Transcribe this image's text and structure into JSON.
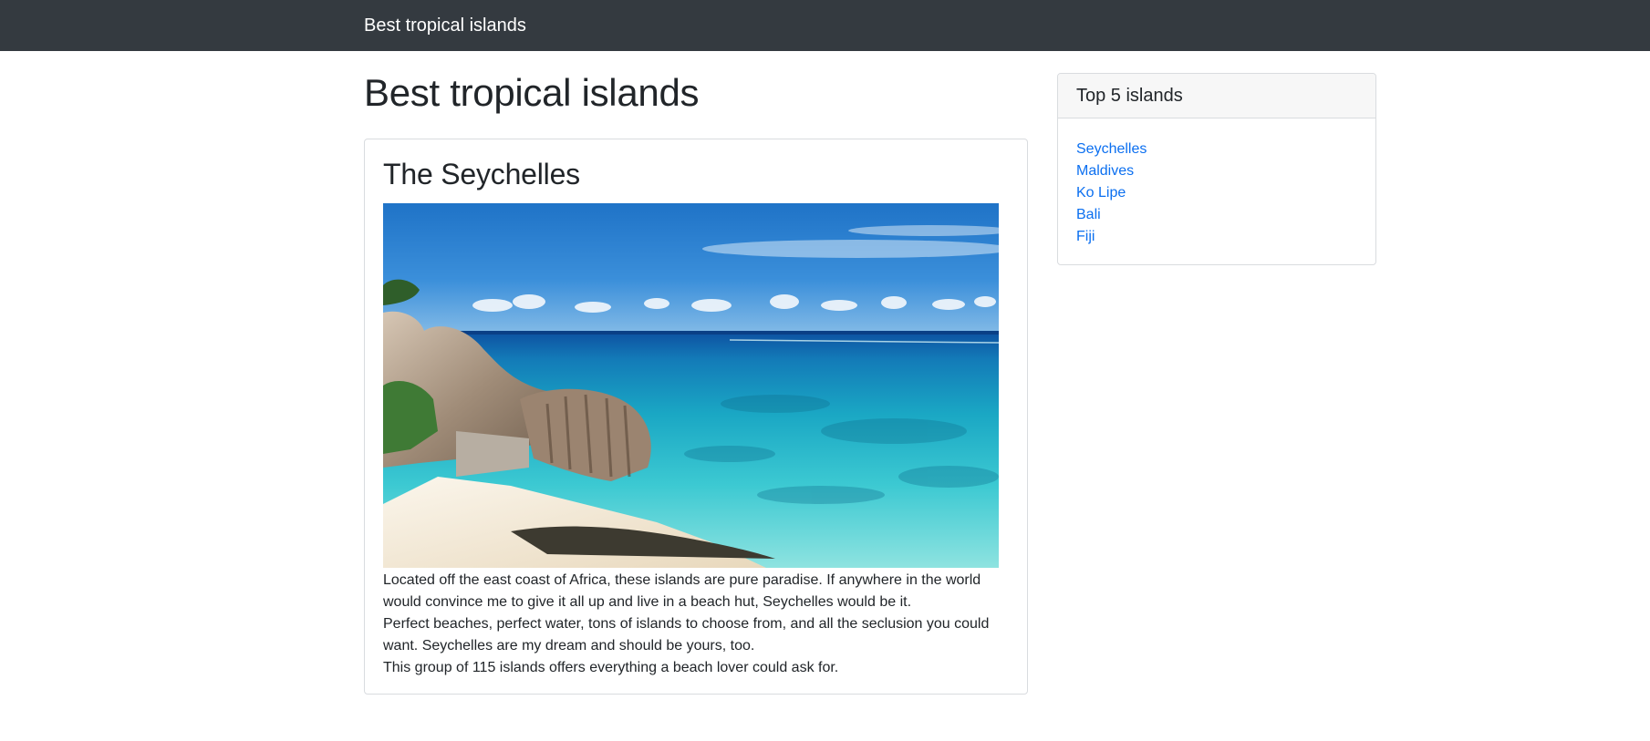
{
  "navbar": {
    "brand": "Best tropical islands"
  },
  "page": {
    "title": "Best tropical islands"
  },
  "article": {
    "title": "The Seychelles",
    "image_description": "Seychelles beach with granite boulders and turquoise sea",
    "paragraphs": [
      "Located off the east coast of Africa, these islands are pure paradise. If anywhere in the world would convince me to give it all up and live in a beach hut, Seychelles would be it.",
      "Perfect beaches, perfect water, tons of islands to choose from, and all the seclusion you could want. Seychelles are my dream and should be yours, too.",
      "This group of 115 islands offers everything a beach lover could ask for."
    ]
  },
  "sidebar": {
    "title": "Top 5 islands",
    "items": [
      {
        "label": "Seychelles"
      },
      {
        "label": "Maldives"
      },
      {
        "label": "Ko Lipe"
      },
      {
        "label": "Bali"
      },
      {
        "label": "Fiji"
      }
    ]
  },
  "colors": {
    "navbar_bg": "#343a40",
    "link": "#0b6ff0",
    "card_border": "#d9dcdf",
    "card_header_bg": "#f7f7f7"
  }
}
